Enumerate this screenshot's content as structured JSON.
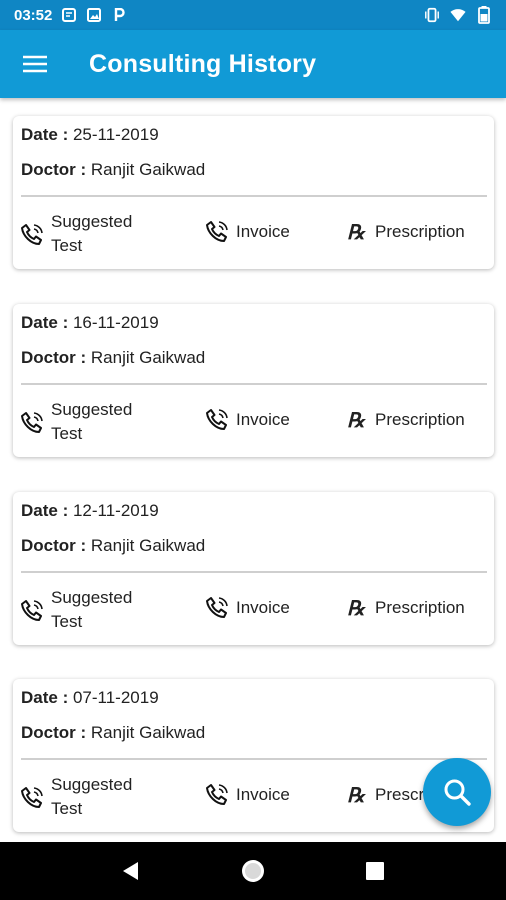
{
  "status_bar": {
    "time": "03:52",
    "icons": [
      "notification-icon",
      "image-icon",
      "parking-icon",
      "vibrate-icon",
      "wifi-icon",
      "battery-icon"
    ]
  },
  "app_bar": {
    "title": "Consulting History",
    "menu_icon": "hamburger-menu-icon"
  },
  "labels": {
    "date": "Date :",
    "doctor": "Doctor :",
    "suggested_line1": "Suggested",
    "suggested_line2": "Test",
    "invoice": "Invoice",
    "prescription": "Prescription",
    "prescription_truncated": "Prescr",
    "rx_symbol": "℞"
  },
  "consultations": [
    {
      "date": "25-11-2019",
      "doctor": "Ranjit Gaikwad"
    },
    {
      "date": "16-11-2019",
      "doctor": "Ranjit Gaikwad"
    },
    {
      "date": "12-11-2019",
      "doctor": "Ranjit Gaikwad"
    },
    {
      "date": "07-11-2019",
      "doctor": "Ranjit Gaikwad"
    }
  ],
  "fab": {
    "icon": "search-icon"
  },
  "nav_bar": {
    "icons": [
      "back-icon",
      "home-icon",
      "recents-icon"
    ]
  },
  "colors": {
    "status_bar": "#0f86c4",
    "app_bar": "#119ad6",
    "fab": "#119ad6"
  }
}
